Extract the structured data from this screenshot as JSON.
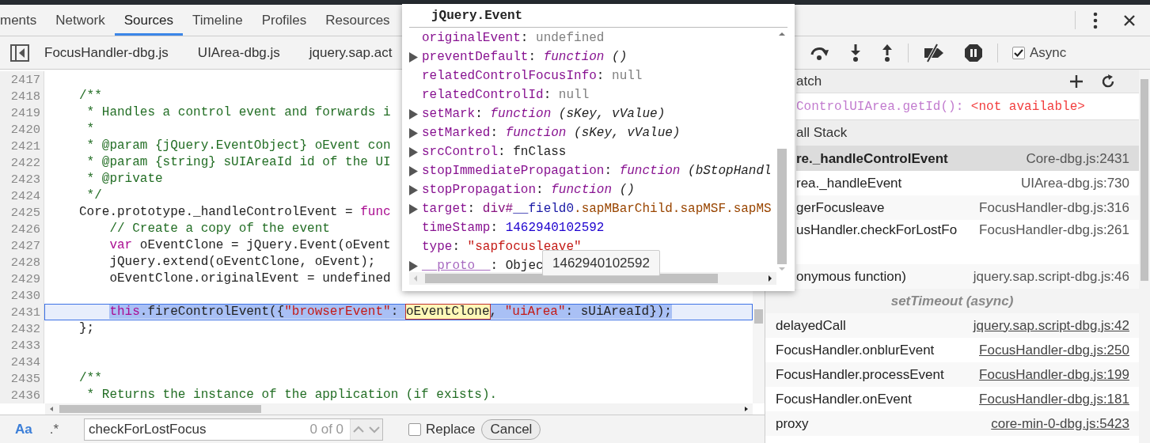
{
  "tabs": [
    {
      "label": "ments",
      "selected": false
    },
    {
      "label": "Network",
      "selected": false
    },
    {
      "label": "Sources",
      "selected": true
    },
    {
      "label": "Timeline",
      "selected": false
    },
    {
      "label": "Profiles",
      "selected": false
    },
    {
      "label": "Resources",
      "selected": false
    }
  ],
  "file_tabs": [
    {
      "label": "FocusHandler-dbg.js"
    },
    {
      "label": "UIArea-dbg.js"
    },
    {
      "label": "jquery.sap.act"
    }
  ],
  "editor": {
    "lines": [
      {
        "number": "2417",
        "current": false
      },
      {
        "number": "2418",
        "current": false,
        "tokens": [
          {
            "kind": "comment",
            "text": "/**"
          }
        ]
      },
      {
        "number": "2419",
        "current": false,
        "tokens": [
          {
            "kind": "comment",
            "text": " * Handles a control event and forwards i"
          }
        ]
      },
      {
        "number": "2420",
        "current": false,
        "tokens": [
          {
            "kind": "comment",
            "text": " *"
          }
        ]
      },
      {
        "number": "2421",
        "current": false,
        "tokens": [
          {
            "kind": "comment",
            "text": " * @param {jQuery.EventObject} oEvent con"
          }
        ]
      },
      {
        "number": "2422",
        "current": false,
        "tokens": [
          {
            "kind": "comment",
            "text": " * @param {string} sUIAreaId id of the UI"
          }
        ]
      },
      {
        "number": "2423",
        "current": false,
        "tokens": [
          {
            "kind": "comment",
            "text": " * @private"
          }
        ]
      },
      {
        "number": "2424",
        "current": false,
        "tokens": [
          {
            "kind": "comment",
            "text": " */"
          }
        ]
      },
      {
        "number": "2425",
        "current": false,
        "tokens": [
          {
            "kind": "plain",
            "text": "Core.prototype._handleControlEvent = "
          },
          {
            "kind": "keyword",
            "text": "func"
          }
        ]
      },
      {
        "number": "2426",
        "current": false,
        "tokens": [
          {
            "kind": "comment",
            "text": "    // Create a copy of the event"
          }
        ]
      },
      {
        "number": "2427",
        "current": false,
        "tokens": [
          {
            "kind": "keyword",
            "text": "    var"
          },
          {
            "kind": "plain",
            "text": " oEventClone = jQuery.Event(oEvent"
          }
        ]
      },
      {
        "number": "2428",
        "current": false,
        "tokens": [
          {
            "kind": "plain",
            "text": "    jQuery.extend(oEventClone, oEvent);"
          }
        ]
      },
      {
        "number": "2429",
        "current": false,
        "tokens": [
          {
            "kind": "plain",
            "text": "    oEventClone.originalEvent = undefined"
          }
        ]
      },
      {
        "number": "2430",
        "current": false
      },
      {
        "number": "2431",
        "current": true,
        "tokens": [
          {
            "kind": "keyword",
            "text": "    this"
          },
          {
            "kind": "plain",
            "text": ".fireControlEvent({"
          },
          {
            "kind": "string",
            "text": "\"browserEvent\""
          },
          {
            "kind": "plain",
            "text": ": "
          },
          {
            "kind": "match",
            "text": "oEventClone"
          },
          {
            "kind": "plain",
            "text": ", "
          },
          {
            "kind": "string",
            "text": "\"uiArea\""
          },
          {
            "kind": "plain",
            "text": ": sUiAreaId});"
          }
        ]
      },
      {
        "number": "2432",
        "current": false,
        "tokens": [
          {
            "kind": "plain",
            "text": "};"
          }
        ]
      },
      {
        "number": "2433",
        "current": false
      },
      {
        "number": "2434",
        "current": false
      },
      {
        "number": "2435",
        "current": false,
        "tokens": [
          {
            "kind": "comment",
            "text": "/**"
          }
        ]
      },
      {
        "number": "2436",
        "current": false,
        "tokens": [
          {
            "kind": "comment",
            "text": " * Returns the instance of the application (if exists)."
          }
        ]
      }
    ]
  },
  "search": {
    "case_label": "Aa",
    "case_sensitive": true,
    "regex_label": ".*",
    "regex": false,
    "value": "checkForLostFocus",
    "count": "0 of 0",
    "replace_label": "Replace",
    "replace_checked": false,
    "cancel_label": "Cancel"
  },
  "debugger": {
    "async_label": "Async",
    "async_checked": true
  },
  "watch": {
    "title": "atch",
    "expressions": [
      {
        "expression": "ControlUIArea.getId():",
        "value": "<not available>"
      }
    ]
  },
  "call_stack": {
    "title": "all Stack",
    "frames": [
      {
        "kind": "frame",
        "name": "re._handleControlEvent",
        "location": "Core-dbg.js:2431",
        "selected": true,
        "linked": false
      },
      {
        "kind": "frame",
        "name": "rea._handleEvent",
        "location": "UIArea-dbg.js:730",
        "selected": false,
        "linked": false
      },
      {
        "kind": "frame",
        "name": "gerFocusleave",
        "location": "FocusHandler-dbg.js:316",
        "selected": false,
        "linked": false
      },
      {
        "kind": "frame",
        "name": "usHandler.checkForLostFo",
        "location": "FocusHandler-dbg.js:261",
        "selected": false,
        "linked": false
      },
      {
        "kind": "frame",
        "name": "onymous function)",
        "location": "jquery.sap.script-dbg.js:46",
        "selected": false,
        "linked": false
      },
      {
        "kind": "async",
        "name": "setTimeout (async)"
      },
      {
        "kind": "frame",
        "name": "delayedCall",
        "location": "jquery.sap.script-dbg.js:42",
        "selected": false,
        "linked": true
      },
      {
        "kind": "frame",
        "name": "FocusHandler.onblurEvent",
        "location": "FocusHandler-dbg.js:250",
        "selected": false,
        "linked": true
      },
      {
        "kind": "frame",
        "name": "FocusHandler.processEvent",
        "location": "FocusHandler-dbg.js:199",
        "selected": false,
        "linked": true
      },
      {
        "kind": "frame",
        "name": "FocusHandler.onEvent",
        "location": "FocusHandler-dbg.js:181",
        "selected": false,
        "linked": true
      },
      {
        "kind": "frame",
        "name": "proxy",
        "location": "core-min-0-dbg.js:5423",
        "selected": false,
        "linked": true
      }
    ]
  },
  "popup": {
    "title": "jQuery.Event",
    "properties": [
      {
        "key": "originalEvent",
        "expandable": false,
        "value": [
          {
            "kind": "punct",
            "text": ": "
          },
          {
            "kind": "null",
            "text": "undefined"
          }
        ]
      },
      {
        "key": "preventDefault",
        "expandable": true,
        "value": [
          {
            "kind": "punct",
            "text": ": "
          },
          {
            "kind": "function",
            "text": "function"
          },
          {
            "kind": "args",
            "text": " ()"
          }
        ]
      },
      {
        "key": "relatedControlFocusInfo",
        "expandable": false,
        "value": [
          {
            "kind": "punct",
            "text": ": "
          },
          {
            "kind": "null",
            "text": "null"
          }
        ]
      },
      {
        "key": "relatedControlId",
        "expandable": false,
        "value": [
          {
            "kind": "punct",
            "text": ": "
          },
          {
            "kind": "null",
            "text": "null"
          }
        ]
      },
      {
        "key": "setMark",
        "expandable": true,
        "value": [
          {
            "kind": "punct",
            "text": ": "
          },
          {
            "kind": "function",
            "text": "function"
          },
          {
            "kind": "args",
            "text": " (sKey, vValue)"
          }
        ]
      },
      {
        "key": "setMarked",
        "expandable": true,
        "value": [
          {
            "kind": "punct",
            "text": ": "
          },
          {
            "kind": "function",
            "text": "function"
          },
          {
            "kind": "args",
            "text": " (sKey, vValue)"
          }
        ]
      },
      {
        "key": "srcControl",
        "expandable": true,
        "value": [
          {
            "kind": "punct",
            "text": ": "
          },
          {
            "kind": "plain",
            "text": "fnClass"
          }
        ]
      },
      {
        "key": "stopImmediatePropagation",
        "expandable": true,
        "value": [
          {
            "kind": "punct",
            "text": ": "
          },
          {
            "kind": "function",
            "text": "function"
          },
          {
            "kind": "args",
            "text": " (bStopHandl"
          }
        ]
      },
      {
        "key": "stopPropagation",
        "expandable": true,
        "value": [
          {
            "kind": "punct",
            "text": ": "
          },
          {
            "kind": "function",
            "text": "function"
          },
          {
            "kind": "args",
            "text": " ()"
          }
        ]
      },
      {
        "key": "target",
        "expandable": true,
        "value": [
          {
            "kind": "punct",
            "text": ": "
          },
          {
            "kind": "tag",
            "text": "div#"
          },
          {
            "kind": "id",
            "text": "__field0"
          },
          {
            "kind": "class",
            "text": ".sapMBarChild.sapMSF.sapMS"
          }
        ]
      },
      {
        "key": "timeStamp",
        "expandable": false,
        "value": [
          {
            "kind": "punct",
            "text": ": "
          },
          {
            "kind": "number",
            "text": "1462940102592"
          }
        ]
      },
      {
        "key": "type",
        "expandable": false,
        "value": [
          {
            "kind": "punct",
            "text": ": "
          },
          {
            "kind": "string",
            "text": "\"sapfocusleave\""
          }
        ]
      },
      {
        "key": "__proto__",
        "expandable": true,
        "value": [
          {
            "kind": "punct",
            "text": ": "
          },
          {
            "kind": "plain",
            "text": "Objec"
          }
        ]
      }
    ],
    "tooltip": "1462940102592"
  }
}
